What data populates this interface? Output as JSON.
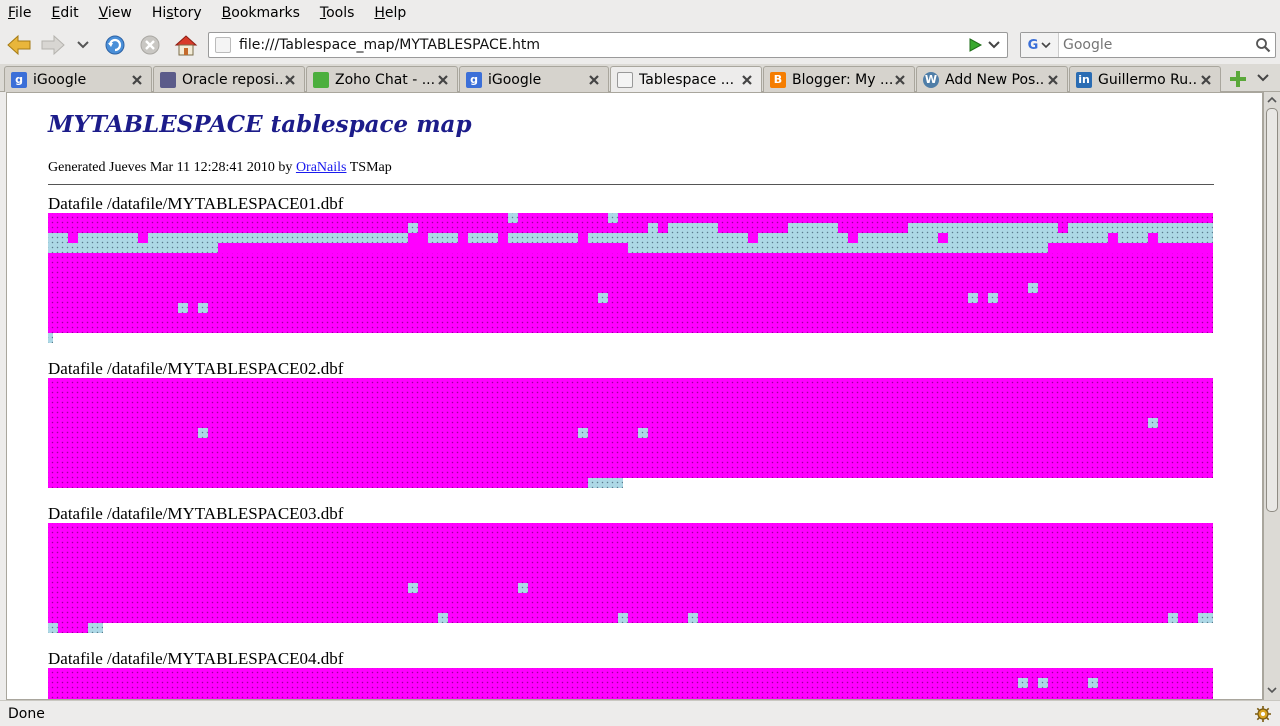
{
  "menu": [
    "File",
    "Edit",
    "View",
    "History",
    "Bookmarks",
    "Tools",
    "Help"
  ],
  "menu_access": [
    "F",
    "E",
    "V",
    "s",
    "B",
    "T",
    "H"
  ],
  "url": "file:///Tablespace_map/MYTABLESPACE.htm",
  "search": {
    "placeholder": "Google"
  },
  "tabs": [
    {
      "label": "iGoogle",
      "icon": "google-icon",
      "active": false
    },
    {
      "label": "Oracle reposi...",
      "icon": "document-icon",
      "active": false
    },
    {
      "label": "Zoho Chat - ...",
      "icon": "chat-icon",
      "active": false
    },
    {
      "label": "iGoogle",
      "icon": "google-icon",
      "active": false
    },
    {
      "label": "Tablespace ...",
      "icon": "page-icon",
      "active": true
    },
    {
      "label": "Blogger: My ...",
      "icon": "blogger-icon",
      "active": false
    },
    {
      "label": "Add New Pos...",
      "icon": "wordpress-icon",
      "active": false
    },
    {
      "label": "Guillermo Ru...",
      "icon": "linkedin-icon",
      "active": false
    }
  ],
  "page": {
    "title": "MYTABLESPACE tablespace map",
    "generated_prefix": "Generated Jueves Mar 11 12:28:41 2010 by",
    "generated_link": "OraNails",
    "generated_suffix": "TSMap",
    "datafiles": [
      "Datafile /datafile/MYTABLESPACE01.dbf",
      "Datafile /datafile/MYTABLESPACE02.dbf",
      "Datafile /datafile/MYTABLESPACE03.dbf",
      "Datafile /datafile/MYTABLESPACE04.dbf"
    ]
  },
  "colors": {
    "used_extent": "#ff00ff",
    "free_extent": "#add8e6",
    "title": "#1c1c8a",
    "link": "#1a1aee"
  },
  "status": "Done"
}
